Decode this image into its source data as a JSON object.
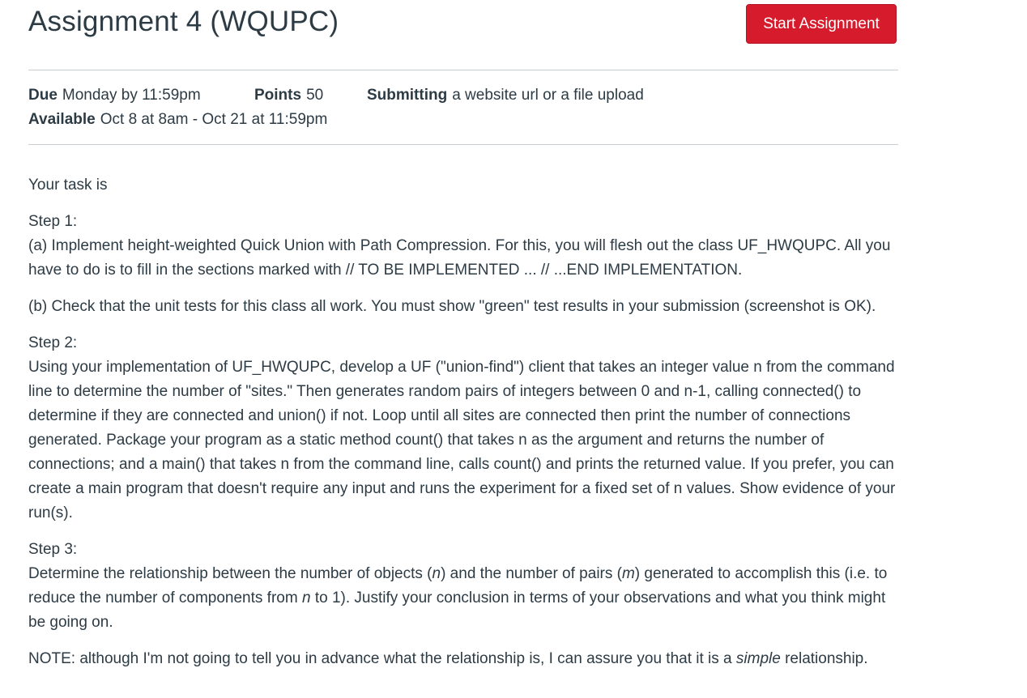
{
  "assignment": {
    "title": "Assignment 4 (WQUPC)",
    "start_button_label": "Start Assignment"
  },
  "details": {
    "due_label": "Due",
    "due_value": "Monday by 11:59pm",
    "points_label": "Points",
    "points_value": "50",
    "submitting_label": "Submitting",
    "submitting_value": "a website url or a file upload",
    "available_label": "Available",
    "available_value": "Oct 8 at 8am - Oct 21 at 11:59pm"
  },
  "description": {
    "intro": "Your task is",
    "step1_heading": "Step 1:",
    "step1_a": "(a) Implement height-weighted Quick Union with Path Compression. For this, you will flesh out the class UF_HWQUPC. All you have to do is to fill in the sections marked with // TO BE IMPLEMENTED ... // ...END IMPLEMENTATION.",
    "step1_b": "(b) Check that the unit tests for this class all work. You must show \"green\" test results in your submission (screenshot is OK).",
    "step2_heading": "Step 2:",
    "step2_body": "Using your implementation of UF_HWQUPC, develop a UF (\"union-find\") client that takes an integer value n from the command line to determine the number of \"sites.\" Then generates random pairs of integers between 0 and n-1, calling connected() to determine if they are connected and union() if not. Loop until all sites are connected then print the number of connections generated. Package your program as a static method count() that takes n as the argument and returns the number of connections; and a main() that takes n from the command line, calls count() and prints the returned value. If you prefer, you can create a main program that doesn't require any input and runs the experiment for a fixed set of n values. Show evidence of your run(s).",
    "step3_heading": "Step 3:",
    "step3_part1": "Determine the relationship between the number of objects (",
    "step3_n1": "n",
    "step3_part2": ") and the number of pairs (",
    "step3_m": "m",
    "step3_part3": ") generated to accomplish this (i.e. to reduce the number of components from ",
    "step3_n2": "n",
    "step3_part4": " to 1). Justify your conclusion in terms of your observations and what you think might be going on.",
    "note_part1": "NOTE: although I'm not going to tell you in advance what the relationship is, I can assure you that it is a ",
    "note_emph": "simple",
    "note_part2": " relationship."
  }
}
